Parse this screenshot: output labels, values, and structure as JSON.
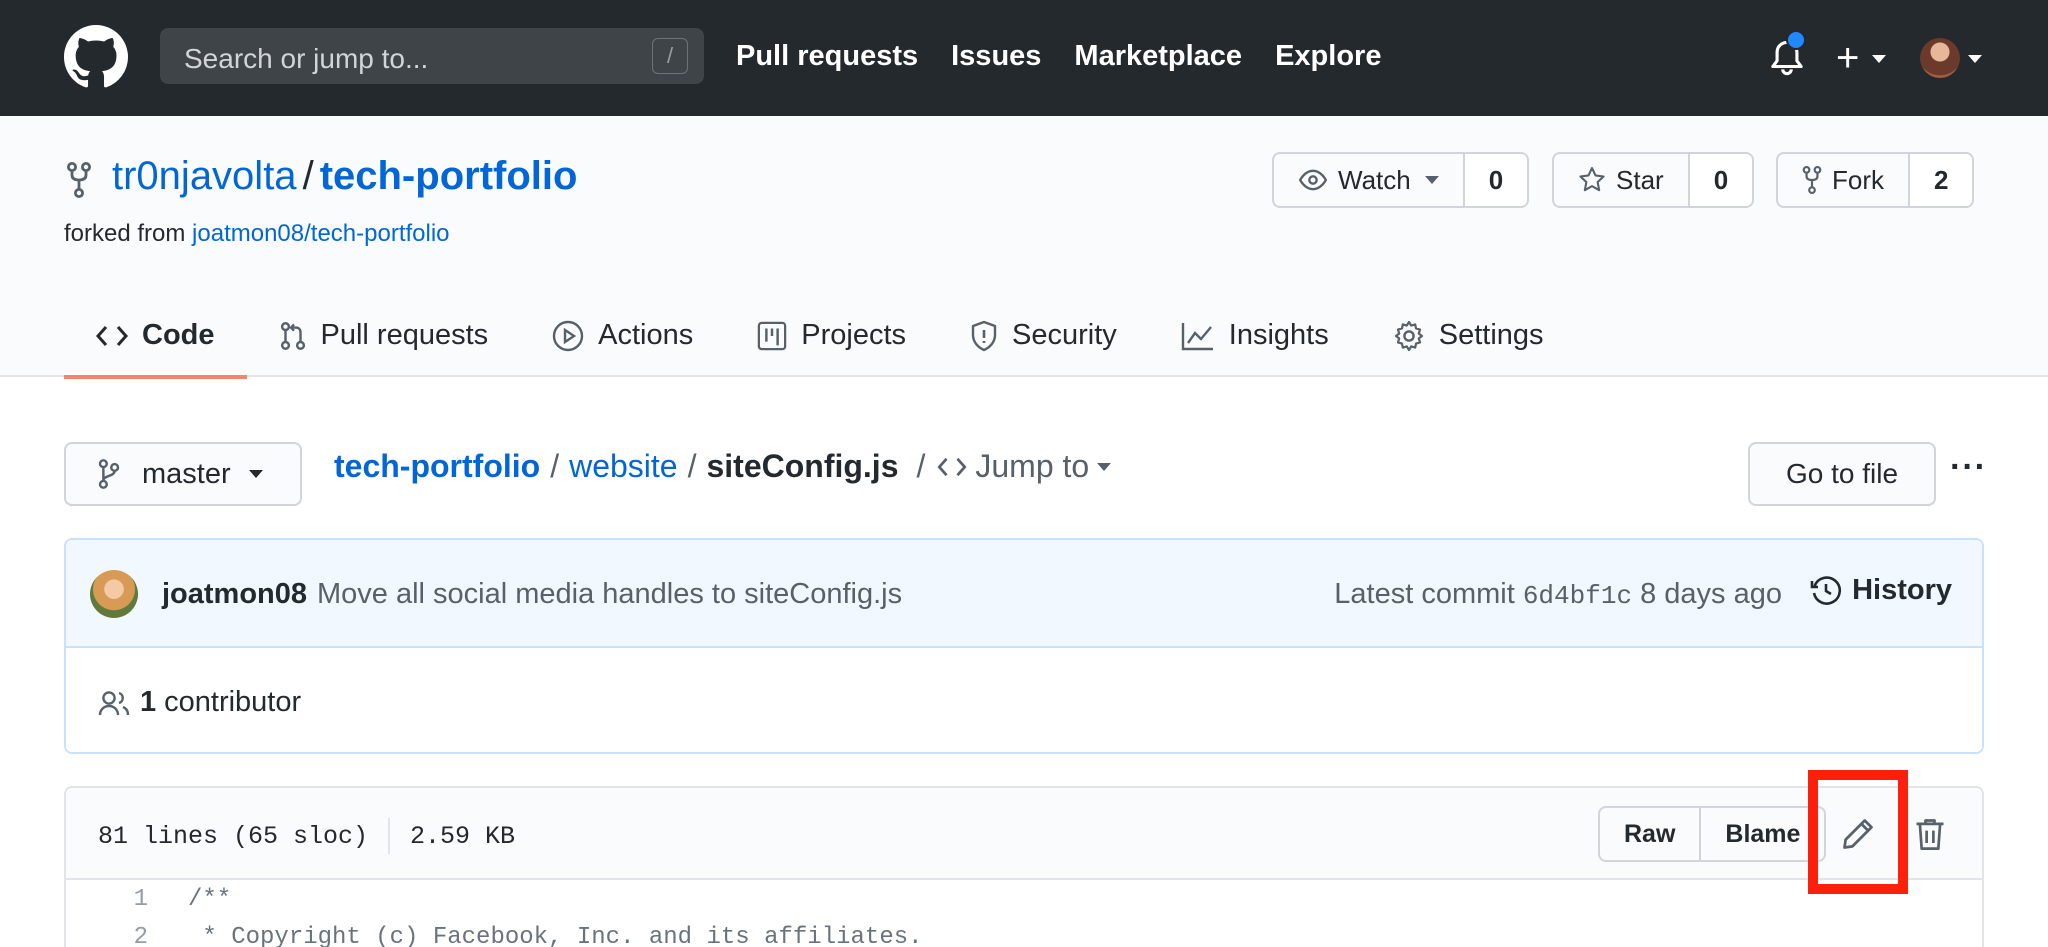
{
  "header": {
    "search_placeholder": "Search or jump to...",
    "search_key": "/",
    "nav": [
      "Pull requests",
      "Issues",
      "Marketplace",
      "Explore"
    ]
  },
  "repo": {
    "owner": "tr0njavolta",
    "separator": "/",
    "name": "tech-portfolio",
    "forked_from_prefix": "forked from",
    "forked_from_link": "joatmon08/tech-portfolio",
    "watch": {
      "label": "Watch",
      "count": "0"
    },
    "star": {
      "label": "Star",
      "count": "0"
    },
    "fork": {
      "label": "Fork",
      "count": "2"
    },
    "tabs": [
      {
        "label": "Code",
        "icon": "code-icon",
        "active": true
      },
      {
        "label": "Pull requests",
        "icon": "pull-request-icon"
      },
      {
        "label": "Actions",
        "icon": "play-icon"
      },
      {
        "label": "Projects",
        "icon": "project-icon"
      },
      {
        "label": "Security",
        "icon": "shield-icon"
      },
      {
        "label": "Insights",
        "icon": "graph-icon"
      },
      {
        "label": "Settings",
        "icon": "gear-icon"
      }
    ]
  },
  "filenav": {
    "branch": "master",
    "breadcrumb": [
      "tech-portfolio",
      "website",
      "siteConfig.js"
    ],
    "sep": "/",
    "jump_to": "Jump to",
    "go_to_file": "Go to file",
    "more": "···"
  },
  "commit": {
    "author": "joatmon08",
    "message": "Move all social media handles to siteConfig.js",
    "latest_label": "Latest commit",
    "sha": "6d4bf1c",
    "when": "8 days ago",
    "history": "History",
    "contributors_count": "1",
    "contributors_label": "contributor"
  },
  "file": {
    "lines_info": "81 lines (65 sloc)",
    "size": "2.59 KB",
    "raw": "Raw",
    "blame": "Blame",
    "code": [
      {
        "n": "1",
        "text": "/**"
      },
      {
        "n": "2",
        "text": " * Copyright (c) Facebook, Inc. and its affiliates."
      }
    ]
  },
  "colors": {
    "header_bg": "#24292e",
    "link": "#0366d6",
    "active_tab_underline": "#f9826c",
    "highlight": "#ff200c",
    "commit_bg": "#f1f8ff"
  }
}
